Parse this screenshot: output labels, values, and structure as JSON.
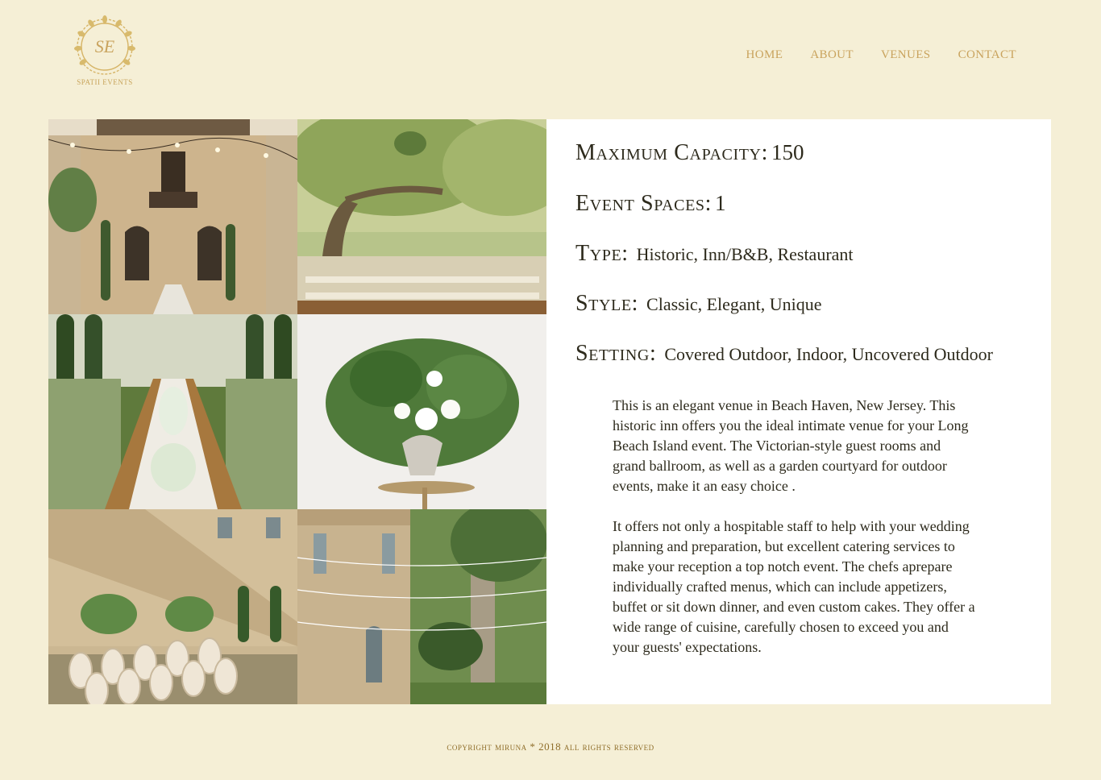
{
  "brand": {
    "monogram": "SE",
    "name": "SPATII EVENTS"
  },
  "nav": {
    "items": [
      "HOME",
      "ABOUT",
      "VENUES",
      "CONTACT"
    ]
  },
  "gallery": {
    "photos": [
      "courtyard-string-lights-photo",
      "oak-tree-reception-photo",
      "cypress-long-table-photo",
      "floral-urn-arrangement-photo",
      "ceremony-chairs-photo",
      "stone-villa-lights-photo"
    ]
  },
  "details": {
    "capacity_label": "Maximum Capacity:",
    "capacity_value": "150",
    "spaces_label": "Event Spaces:",
    "spaces_value": "1",
    "type_label": "Type:",
    "type_value": "Historic, Inn/B&B, Restaurant",
    "style_label": "Style:",
    "style_value": "Classic, Elegant, Unique",
    "setting_label": "Setting:",
    "setting_value": "Covered Outdoor, Indoor, Uncovered Outdoor"
  },
  "description": {
    "paragraph_1": "This is an elegant venue in Beach Haven, New Jersey. This historic inn offers you the ideal intimate venue for your Long Beach Island event.  The Victorian-style guest rooms and grand ballroom, as well as a garden courtyard for outdoor events, make it an easy choice .",
    "paragraph_2": "It offers not only a hospitable staff to help with your wedding planning and preparation, but excellent catering services to make your reception a top notch event. The chefs aprepare individually crafted menus, which can include appetizers, buffet or sit down dinner, and even custom cakes. They offer a wide range of cuisine, carefully chosen to exceed you and your guests' expectations."
  },
  "footer": {
    "text": "copyright miruna * 2018 all rights reserved"
  },
  "colors": {
    "background": "#f5efd6",
    "gold": "#c9a35d",
    "card": "#ffffff",
    "text": "#2d2a1c"
  }
}
